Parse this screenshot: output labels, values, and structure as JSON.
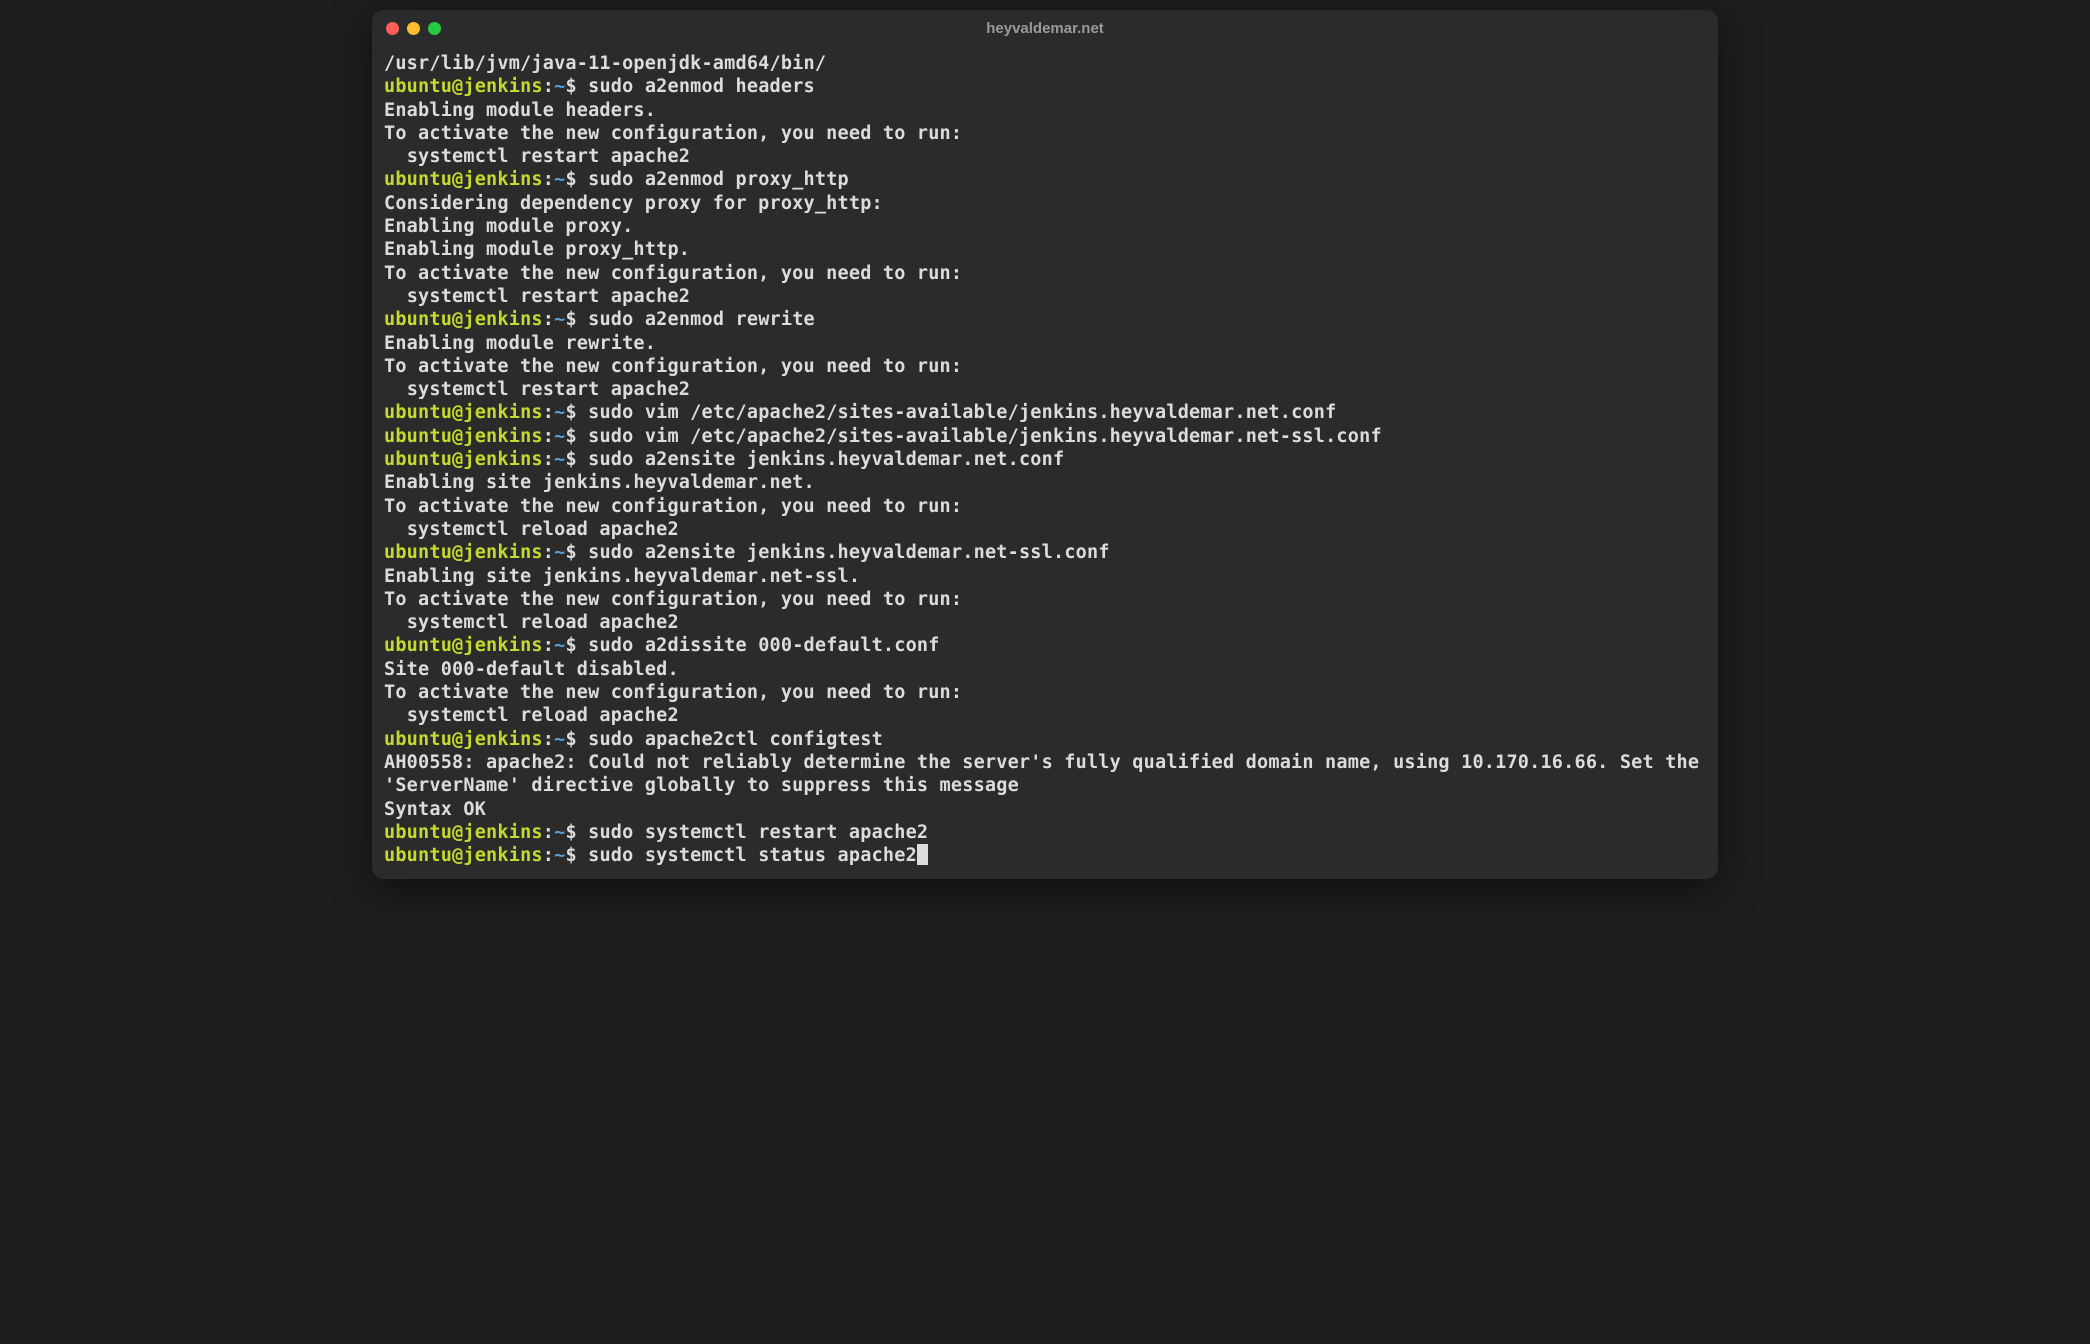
{
  "window": {
    "title": "heyvaldemar.net"
  },
  "prompt": {
    "user": "ubuntu",
    "at": "@",
    "host": "jenkins",
    "colon": ":",
    "path": "~",
    "symbol": "$"
  },
  "lines": [
    {
      "type": "out",
      "text": "/usr/lib/jvm/java-11-openjdk-amd64/bin/"
    },
    {
      "type": "cmd",
      "text": "sudo a2enmod headers"
    },
    {
      "type": "out",
      "text": "Enabling module headers."
    },
    {
      "type": "out",
      "text": "To activate the new configuration, you need to run:"
    },
    {
      "type": "out",
      "text": "  systemctl restart apache2"
    },
    {
      "type": "cmd",
      "text": "sudo a2enmod proxy_http"
    },
    {
      "type": "out",
      "text": "Considering dependency proxy for proxy_http:"
    },
    {
      "type": "out",
      "text": "Enabling module proxy."
    },
    {
      "type": "out",
      "text": "Enabling module proxy_http."
    },
    {
      "type": "out",
      "text": "To activate the new configuration, you need to run:"
    },
    {
      "type": "out",
      "text": "  systemctl restart apache2"
    },
    {
      "type": "cmd",
      "text": "sudo a2enmod rewrite"
    },
    {
      "type": "out",
      "text": "Enabling module rewrite."
    },
    {
      "type": "out",
      "text": "To activate the new configuration, you need to run:"
    },
    {
      "type": "out",
      "text": "  systemctl restart apache2"
    },
    {
      "type": "cmd",
      "text": "sudo vim /etc/apache2/sites-available/jenkins.heyvaldemar.net.conf"
    },
    {
      "type": "cmd",
      "text": "sudo vim /etc/apache2/sites-available/jenkins.heyvaldemar.net-ssl.conf"
    },
    {
      "type": "cmd",
      "text": "sudo a2ensite jenkins.heyvaldemar.net.conf"
    },
    {
      "type": "out",
      "text": "Enabling site jenkins.heyvaldemar.net."
    },
    {
      "type": "out",
      "text": "To activate the new configuration, you need to run:"
    },
    {
      "type": "out",
      "text": "  systemctl reload apache2"
    },
    {
      "type": "cmd",
      "text": "sudo a2ensite jenkins.heyvaldemar.net-ssl.conf"
    },
    {
      "type": "out",
      "text": "Enabling site jenkins.heyvaldemar.net-ssl."
    },
    {
      "type": "out",
      "text": "To activate the new configuration, you need to run:"
    },
    {
      "type": "out",
      "text": "  systemctl reload apache2"
    },
    {
      "type": "cmd",
      "text": "sudo a2dissite 000-default.conf"
    },
    {
      "type": "out",
      "text": "Site 000-default disabled."
    },
    {
      "type": "out",
      "text": "To activate the new configuration, you need to run:"
    },
    {
      "type": "out",
      "text": "  systemctl reload apache2"
    },
    {
      "type": "cmd",
      "text": "sudo apache2ctl configtest"
    },
    {
      "type": "out",
      "text": "AH00558: apache2: Could not reliably determine the server's fully qualified domain name, using 10.170.16.66. Set the 'ServerName' directive globally to suppress this message"
    },
    {
      "type": "out",
      "text": "Syntax OK"
    },
    {
      "type": "cmd",
      "text": "sudo systemctl restart apache2"
    },
    {
      "type": "cmd",
      "text": "sudo systemctl status apache2",
      "cursor": true
    }
  ]
}
